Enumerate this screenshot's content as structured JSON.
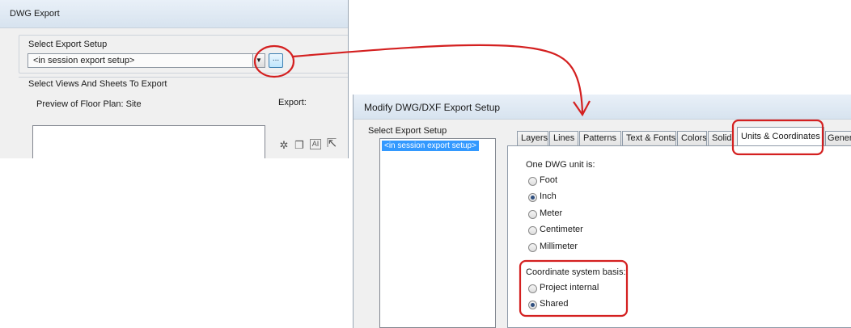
{
  "dwg_export": {
    "title": "DWG Export",
    "setup_group_label": "Select Export Setup",
    "setup_value": "<in session export setup>",
    "browse_label": "...",
    "views_group_label": "Select Views And Sheets To Export",
    "preview_label": "Preview of Floor Plan: Site",
    "export_label": "Export:"
  },
  "modify_dialog": {
    "title": "Modify DWG/DXF Export Setup",
    "setup_group_label": "Select Export Setup",
    "setup_list": [
      "<in session export setup>"
    ],
    "tabs": [
      "Layers",
      "Lines",
      "Patterns",
      "Text & Fonts",
      "Colors",
      "Solids",
      "Units & Coordinates",
      "General"
    ],
    "active_tab": "Units & Coordinates",
    "unit_label": "One DWG unit is:",
    "units": [
      {
        "label": "Foot",
        "selected": false
      },
      {
        "label": "Inch",
        "selected": true
      },
      {
        "label": "Meter",
        "selected": false
      },
      {
        "label": "Centimeter",
        "selected": false
      },
      {
        "label": "Millimeter",
        "selected": false
      }
    ],
    "coord_label": "Coordinate system basis:",
    "coords": [
      {
        "label": "Project internal",
        "selected": false
      },
      {
        "label": "Shared",
        "selected": true
      }
    ]
  },
  "colors": {
    "annotation": "#d42020",
    "selection": "#3399ff"
  }
}
